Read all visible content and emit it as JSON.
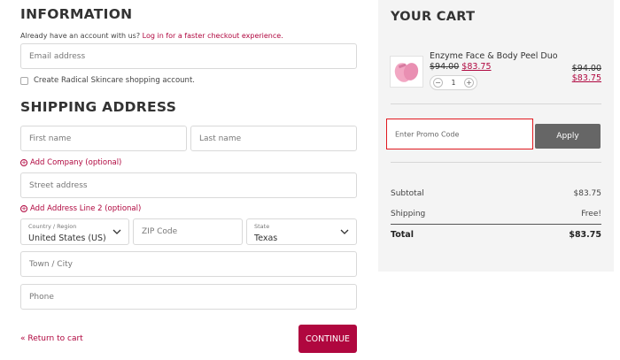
{
  "info": {
    "title": "INFORMATION",
    "account_text": "Already have an account with us?",
    "login_link": "Log in for a faster checkout experience.",
    "email_placeholder": "Email address",
    "create_account": "Create Radical Skincare shopping account."
  },
  "shipping": {
    "title": "SHIPPING ADDRESS",
    "first_name": "First name",
    "last_name": "Last name",
    "add_company": "Add Company (optional)",
    "street": "Street address",
    "add_line2": "Add Address Line 2 (optional)",
    "country_label": "Country / Region",
    "country_value": "United States (US)",
    "zip": "ZIP Code",
    "state_label": "State",
    "state_value": "Texas",
    "town": "Town / City",
    "phone": "Phone"
  },
  "footer": {
    "return_link": "« Return to cart",
    "continue": "CONTINUE"
  },
  "cart": {
    "title": "YOUR CART",
    "item_name": "Enzyme Face & Body Peel Duo",
    "old_price": "$94.00",
    "new_price": "$83.75",
    "qty": "1",
    "minus": "−",
    "plus": "+",
    "line_old": "$94.00",
    "line_new": "$83.75",
    "promo_placeholder": "Enter Promo Code",
    "apply": "Apply",
    "subtotal_label": "Subtotal",
    "subtotal_value": "$83.75",
    "shipping_label": "Shipping",
    "shipping_value": "Free!",
    "total_label": "Total",
    "total_value": "$83.75"
  },
  "colors": {
    "accent": "#b0073f",
    "apply_bg": "#666666",
    "promo_border": "#e0191f"
  }
}
